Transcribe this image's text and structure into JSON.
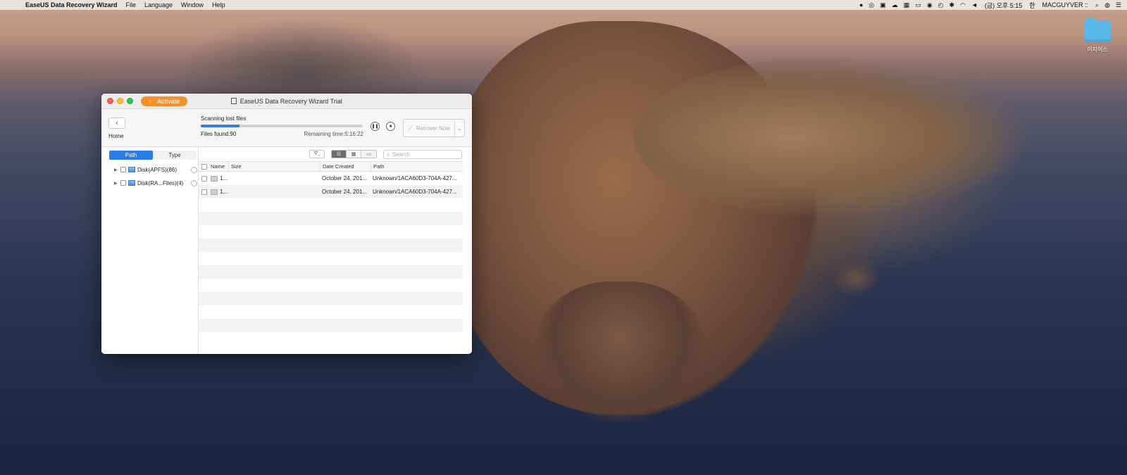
{
  "menubar": {
    "apple_glyph": "",
    "app_name": "EaseUS Data Recovery Wizard",
    "menus": [
      "File",
      "Language",
      "Window",
      "Help"
    ],
    "clock": "(금) 오후 5:15",
    "user": "MACGUYVER ::"
  },
  "desktop": {
    "folder_label": "이지어스"
  },
  "window": {
    "title": "EaseUS Data Recovery Wizard Trial",
    "activate_label": "Activate",
    "home_label": "Home",
    "scan_status": "Scanning lost files",
    "files_found": "Files found:90",
    "remaining_time": "Remaining time:5:16:22",
    "progress_percent": 24,
    "recover_label": "Recover Now",
    "tabs": {
      "path": "Path",
      "type": "Type"
    },
    "tree": [
      {
        "label": "Disk(APFS)(86)"
      },
      {
        "label": "Disk(RA...Files)(4)"
      }
    ],
    "search_placeholder": "Search",
    "columns": {
      "name": "Name",
      "size": "Size",
      "date": "Date Created",
      "path": "Path"
    },
    "rows": [
      {
        "name": "1...",
        "size": "",
        "date": "October 24, 201...",
        "path": "Unknown/1ACA60D3-704A-427..."
      },
      {
        "name": "1...",
        "size": "",
        "date": "October 24, 201...",
        "path": "Unknown/1ACA60D3-704A-427..."
      }
    ]
  },
  "colors": {
    "accent": "#2c7ce6",
    "activate": "#f5902a",
    "progress": "#3b7bd6"
  }
}
